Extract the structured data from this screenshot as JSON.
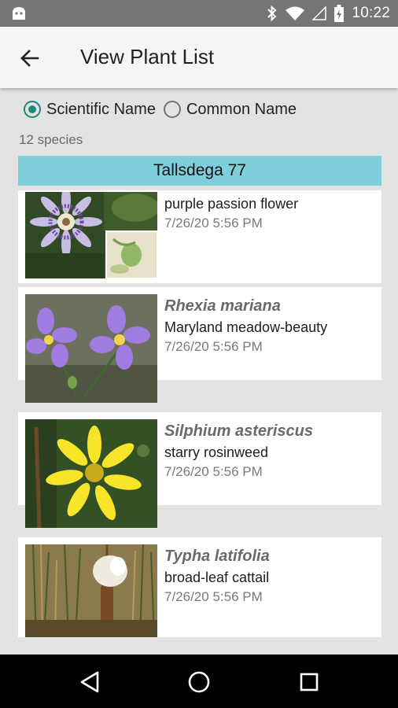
{
  "status_bar": {
    "time": "10:22",
    "icons": [
      "android-icon",
      "bluetooth-icon",
      "wifi-icon",
      "signal-icon",
      "battery-charging-icon"
    ]
  },
  "app_bar": {
    "title": "View Plant List",
    "back_icon": "arrow-back-icon"
  },
  "name_mode": {
    "options": [
      {
        "label": "Scientific Name",
        "selected": true
      },
      {
        "label": "Common Name",
        "selected": false
      }
    ],
    "accent_color": "#1c8a7a"
  },
  "species_count": "12 species",
  "group": {
    "title": "Tallsdega 77",
    "color": "#7ecfdb"
  },
  "plants": [
    {
      "scientific_name": "",
      "common_name": "purple passion flower",
      "date": "7/26/20 5:56 PM",
      "photo": "passion-flower-photo"
    },
    {
      "scientific_name": "Rhexia mariana",
      "common_name": "Maryland meadow-beauty",
      "date": "7/26/20 5:56 PM",
      "photo": "meadow-beauty-photo"
    },
    {
      "scientific_name": "Silphium asteriscus",
      "common_name": "starry rosinweed",
      "date": "7/26/20 5:56 PM",
      "photo": "rosinweed-photo"
    },
    {
      "scientific_name": "Typha latifolia",
      "common_name": "broad-leaf cattail",
      "date": "7/26/20 5:56 PM",
      "photo": "cattail-photo"
    }
  ],
  "nav_bar": {
    "buttons": [
      "back-triangle-icon",
      "home-circle-icon",
      "recents-square-icon"
    ]
  }
}
